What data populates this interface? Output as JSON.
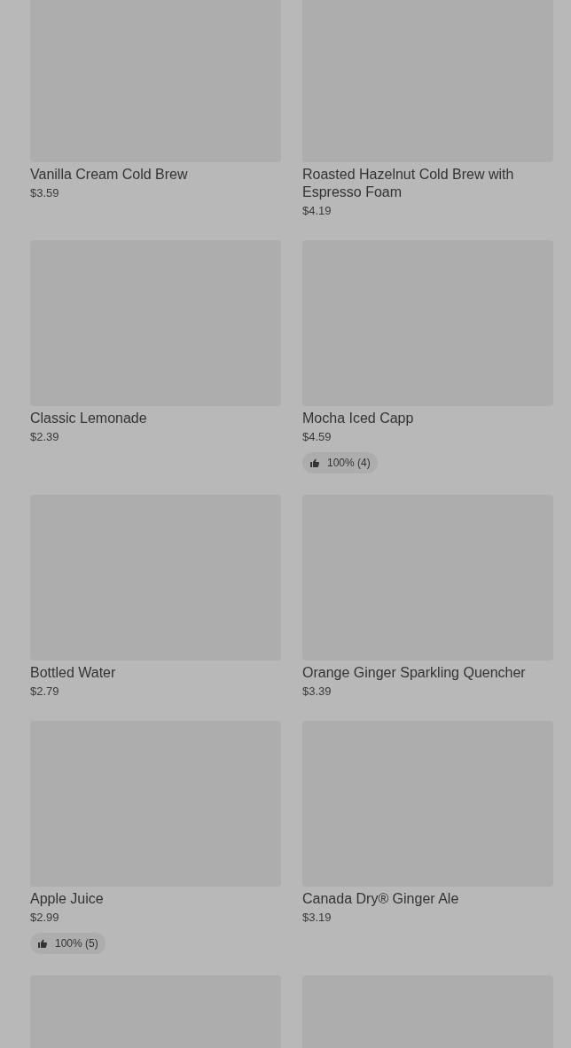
{
  "products": [
    {
      "kind": "product",
      "name": "Vanilla Cream Cold Brew",
      "price": "$3.59"
    },
    {
      "kind": "product",
      "name": "Roasted Hazelnut Cold Brew with Espresso Foam",
      "price": "$4.19"
    },
    {
      "kind": "product",
      "name": "Classic Lemonade",
      "price": "$2.39"
    },
    {
      "kind": "product",
      "name": "Mocha Iced Capp",
      "price": "$4.59",
      "rating": "100% (4)"
    },
    {
      "kind": "product",
      "name": "Bottled Water",
      "price": "$2.79"
    },
    {
      "kind": "product",
      "name": "Orange Ginger Sparkling Quencher",
      "price": "$3.39"
    },
    {
      "kind": "product",
      "name": "Apple Juice",
      "price": "$2.99",
      "rating": "100% (5)"
    },
    {
      "kind": "product",
      "name": "Canada Dry® Ginger Ale",
      "price": "$3.19"
    },
    {
      "kind": "image"
    },
    {
      "kind": "image"
    }
  ]
}
